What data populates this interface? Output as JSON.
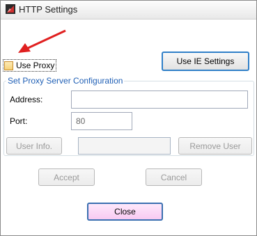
{
  "window": {
    "title": "HTTP Settings"
  },
  "use_proxy": {
    "label": "Use Proxy",
    "checked": false
  },
  "buttons": {
    "use_ie_settings": "Use IE Settings",
    "user_info": "User Info.",
    "remove_user": "Remove User",
    "accept": "Accept",
    "cancel": "Cancel",
    "close": "Close"
  },
  "proxy_config": {
    "group_title": "Set Proxy Server Configuration",
    "address_label": "Address:",
    "address_value": "",
    "port_label": "Port:",
    "port_value": "80",
    "user_info_value": ""
  },
  "colors": {
    "group_title": "#1f5fb5",
    "annotation_arrow": "#e02020",
    "close_button_fill": "#f8caf2"
  },
  "icons": [
    "app-icon",
    "red-arrow-annotation"
  ]
}
